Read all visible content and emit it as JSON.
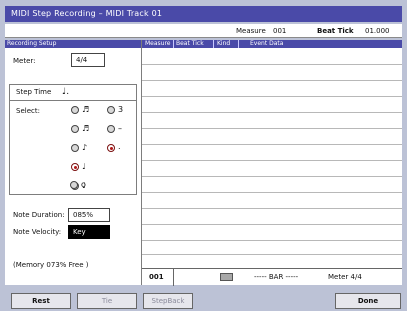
{
  "title": "MIDI Step Recording – MIDI Track 01",
  "info": {
    "measure_label": "Measure",
    "measure_value": "001",
    "beat_tick_label": "Beat Tick",
    "beat_tick_value": "01.000"
  },
  "left_panel": {
    "header": "Recording Setup",
    "meter_label": "Meter:",
    "meter_value": "4/4",
    "step_time_label": "Step Time",
    "step_time_value": "♩.",
    "select_label": "Select:",
    "radios": [
      {
        "glyph": "♬",
        "selected": false
      },
      {
        "glyph": "3",
        "selected": false
      },
      {
        "glyph": "♬",
        "selected": false
      },
      {
        "glyph": "–",
        "selected": false
      },
      {
        "glyph": "♪",
        "selected": false
      },
      {
        "glyph": ".",
        "selected": true
      },
      {
        "glyph": "♩",
        "selected": true
      },
      {
        "glyph": "♩",
        "selected": false
      },
      {
        "glyph": "o",
        "selected": false
      }
    ],
    "note_duration_label": "Note Duration:",
    "note_duration_value": "085%",
    "note_velocity_label": "Note Velocity:",
    "note_velocity_value": "Key",
    "memory_text": "(Memory  073% Free  )"
  },
  "table": {
    "headers": [
      "Measure",
      "Beat Tick",
      "Kind",
      "Event Data"
    ],
    "footer": {
      "measure": "001",
      "bar_text": "----- BAR -----",
      "meter_text": "Meter  4/4"
    }
  },
  "buttons": {
    "rest": "Rest",
    "tie": "Tie",
    "stepback": "StepBack",
    "done": "Done"
  },
  "colors": {
    "accent": "#4a4aa8",
    "background": "#bcc2d6",
    "selected_radio": "#b01818"
  }
}
